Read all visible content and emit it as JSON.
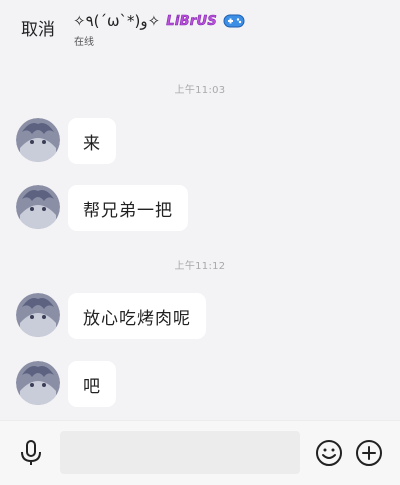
{
  "header": {
    "cancel_label": "取消",
    "nickname": "✧٩(ˊωˋ*)و✧",
    "badge_text": "LiBrUS",
    "status": "在线"
  },
  "chat": {
    "items": [
      {
        "kind": "time",
        "text": "上午11:03"
      },
      {
        "kind": "message",
        "text": "来"
      },
      {
        "kind": "message",
        "text": "帮兄弟一把"
      },
      {
        "kind": "time",
        "text": "上午11:12"
      },
      {
        "kind": "message",
        "text": "放心吃烤肉呢"
      },
      {
        "kind": "message",
        "text": "吧"
      }
    ]
  },
  "input_bar": {
    "message_value": "",
    "icons": [
      "microphone-icon",
      "emoji-icon",
      "plus-icon"
    ]
  },
  "colors": {
    "background": "#f3f2f5",
    "bubble": "#ffffff",
    "badge": "#c04fe0",
    "timestamp": "#a9a9a9"
  }
}
